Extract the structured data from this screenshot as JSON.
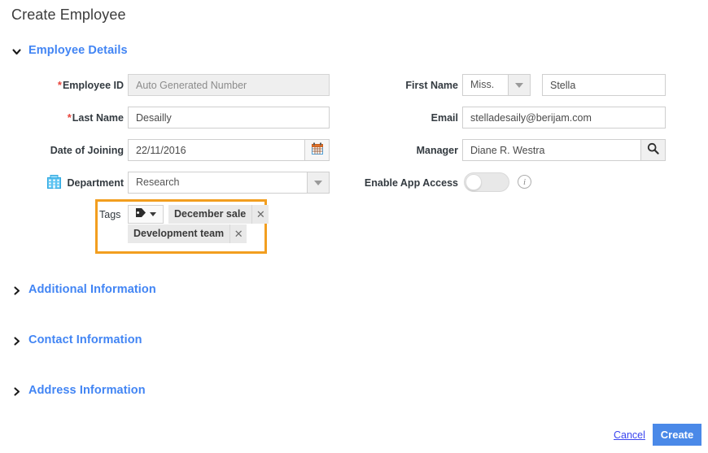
{
  "page": {
    "title": "Create Employee"
  },
  "sections": [
    {
      "label": "Employee Details",
      "state": "expanded",
      "icon": "chevron-down-icon"
    },
    {
      "label": "Additional Information",
      "state": "collapsed",
      "icon": "chevron-right-icon"
    },
    {
      "label": "Contact Information",
      "state": "collapsed",
      "icon": "chevron-right-icon"
    },
    {
      "label": "Address Information",
      "state": "collapsed",
      "icon": "chevron-right-icon"
    }
  ],
  "form": {
    "employee_id": {
      "label": "Employee ID",
      "required": true,
      "value": "Auto Generated Number",
      "readonly": true
    },
    "last_name": {
      "label": "Last Name",
      "required": true,
      "value": "Desailly"
    },
    "date_joining": {
      "label": "Date of Joining",
      "required": false,
      "value": "22/11/2016",
      "icon": "calendar-icon"
    },
    "department": {
      "label": "Department",
      "required": false,
      "value": "Research",
      "icon": "building-icon"
    },
    "tags": {
      "label": "Tags",
      "picker_icon": "tag-icon",
      "chips": [
        {
          "label": "December sale",
          "remove": "✕"
        },
        {
          "label": "Development team",
          "remove": "✕"
        }
      ]
    },
    "first_name": {
      "label": "First Name",
      "salutation": "Miss.",
      "value": "Stella"
    },
    "email": {
      "label": "Email",
      "value": "stelladesaily@berijam.com"
    },
    "manager": {
      "label": "Manager",
      "value": "Diane R. Westra",
      "icon": "search-icon"
    },
    "app_access": {
      "label": "Enable App Access",
      "state": "off",
      "info_icon": "info-icon",
      "info_glyph": "i"
    }
  },
  "footer": {
    "cancel_label": "Cancel",
    "create_label": "Create"
  },
  "colors": {
    "accent_blue": "#4285f4",
    "highlight_orange": "#f29e1f",
    "required_red": "#e8453c",
    "button_blue": "#4a89e8",
    "link_blue": "#3b46f0"
  }
}
